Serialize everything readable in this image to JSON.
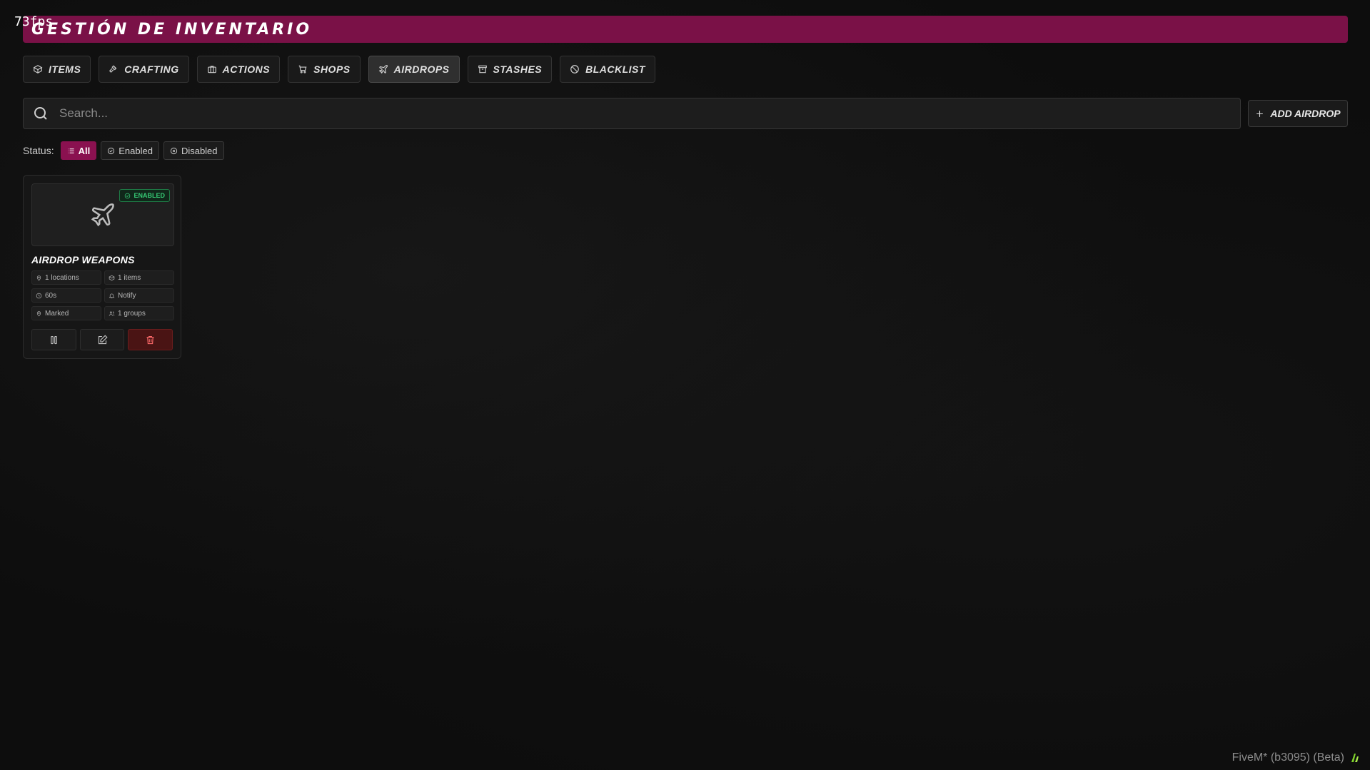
{
  "overlay": {
    "fps": "73fps"
  },
  "header": {
    "title": "GESTIÓN DE INVENTARIO",
    "accent_color": "#7a1147"
  },
  "tabs": [
    {
      "label": "ITEMS",
      "icon": "box-icon"
    },
    {
      "label": "CRAFTING",
      "icon": "hammer-icon"
    },
    {
      "label": "ACTIONS",
      "icon": "briefcase-icon"
    },
    {
      "label": "SHOPS",
      "icon": "cart-icon"
    },
    {
      "label": "AIRDROPS",
      "icon": "plane-icon",
      "active": true
    },
    {
      "label": "STASHES",
      "icon": "archive-icon"
    },
    {
      "label": "BLACKLIST",
      "icon": "ban-icon"
    }
  ],
  "search": {
    "placeholder": "Search...",
    "value": ""
  },
  "add_button": {
    "label": "ADD AIRDROP"
  },
  "status_filter": {
    "label": "Status:",
    "options": [
      {
        "label": "All",
        "active": true
      },
      {
        "label": "Enabled",
        "active": false
      },
      {
        "label": "Disabled",
        "active": false
      }
    ]
  },
  "airdrops": [
    {
      "name": "AIRDROP WEAPONS",
      "status": "ENABLED",
      "stats": {
        "locations": "1 locations",
        "items": "1 items",
        "time": "60s",
        "notify": "Notify",
        "marked": "Marked",
        "groups": "1 groups"
      }
    }
  ],
  "footer": {
    "watermark": "FiveM* (b3095) (Beta)"
  }
}
